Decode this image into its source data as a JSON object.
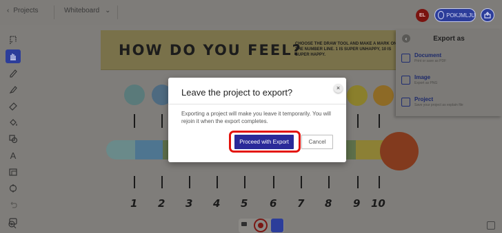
{
  "header": {
    "back_label": "Projects",
    "board_label": "Whiteboard",
    "avatar_initials": "EL",
    "user_name": "POKJMLJU"
  },
  "banner": {
    "title": "HOW DO YOU FEEL?",
    "note": "Choose the draw tool and make a mark on the number line. 1 is super unhappy, 10 is super happy."
  },
  "scale_numbers": [
    "1",
    "2",
    "3",
    "4",
    "5",
    "6",
    "7",
    "8",
    "9",
    "10"
  ],
  "export_panel": {
    "title": "Export as",
    "items": [
      {
        "label": "Document",
        "sub": "Print or save as PDF",
        "icon": "printer-icon"
      },
      {
        "label": "Image",
        "sub": "Export as PNG",
        "icon": "image-icon"
      },
      {
        "label": "Project",
        "sub": "Save your project as explain file",
        "icon": "project-icon"
      }
    ]
  },
  "modal": {
    "title": "Leave the project to export?",
    "body": "Exporting a project will make you leave it temporarily. You will rejoin it when the export completes.",
    "proceed_label": "Proceed with Export",
    "cancel_label": "Cancel",
    "close_glyph": "×"
  },
  "colors": {
    "accent": "#2c3d9a",
    "highlight": "#e3120b",
    "dim_background": "#7f7d7a"
  }
}
